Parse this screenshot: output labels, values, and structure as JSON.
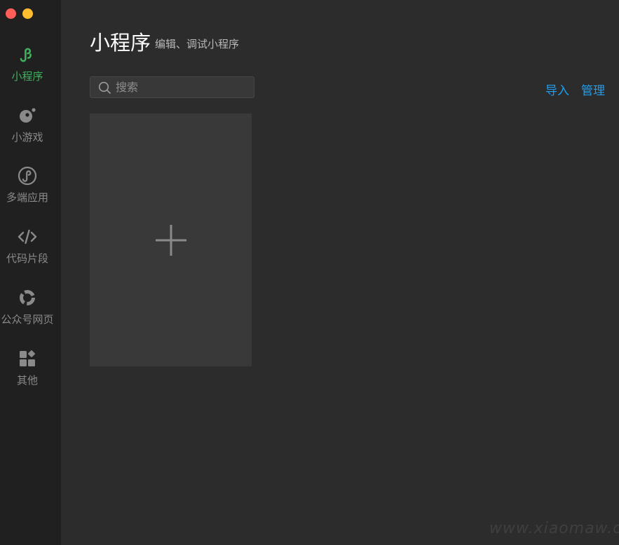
{
  "sidebar": {
    "items": [
      {
        "label": "小程序",
        "icon": "mini-program-icon",
        "active": true
      },
      {
        "label": "小游戏",
        "icon": "mini-game-icon",
        "active": false
      },
      {
        "label": "多端应用",
        "icon": "multi-platform-icon",
        "active": false
      },
      {
        "label": "代码片段",
        "icon": "code-snippet-icon",
        "active": false
      },
      {
        "label": "公众号网页",
        "icon": "official-account-icon",
        "active": false
      },
      {
        "label": "其他",
        "icon": "other-apps-icon",
        "active": false
      }
    ]
  },
  "header": {
    "title": "小程序",
    "subtitle": "编辑、调试小程序"
  },
  "search": {
    "placeholder": "搜索",
    "value": ""
  },
  "actions": {
    "import_label": "导入",
    "manage_label": "管理"
  },
  "add_card": {
    "icon": "plus-icon"
  },
  "watermark": {
    "text": "www.xiaomaw.cn"
  },
  "colors": {
    "accent_green": "#3fb15e",
    "link_blue": "#1e9ff2",
    "background": "#2c2c2c",
    "sidebar": "#202020"
  }
}
